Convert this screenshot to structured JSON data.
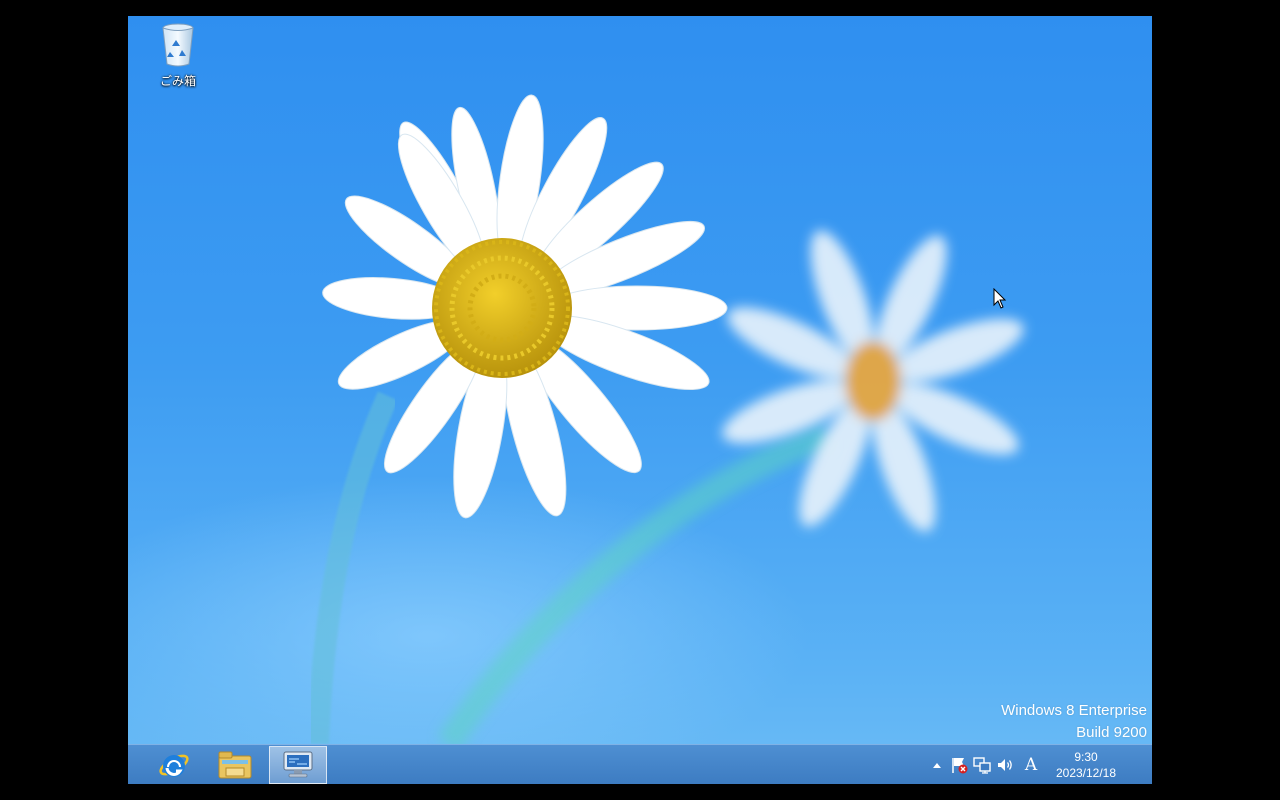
{
  "desktop": {
    "icons": [
      {
        "label": "ごみ箱",
        "icon": "recycle-bin-icon"
      }
    ],
    "watermark": {
      "line1": "Windows 8 Enterprise",
      "line2": "Build 9200"
    }
  },
  "taskbar": {
    "pinned": [
      {
        "name": "Internet Explorer",
        "icon": "internet-explorer-icon"
      },
      {
        "name": "File Explorer",
        "icon": "file-explorer-icon"
      },
      {
        "name": "Remote Desktop",
        "icon": "remote-desktop-icon",
        "active": true
      }
    ],
    "tray": {
      "icons": [
        "show-hidden-icons-arrow",
        "action-center-flag-icon",
        "network-icon",
        "volume-icon"
      ],
      "ime_mode": "A",
      "time": "9:30",
      "date": "2023/12/18"
    }
  },
  "colors": {
    "sky": "#3d9cf2",
    "taskbar": "#4585c9",
    "daisy_center": "#e8c020"
  }
}
